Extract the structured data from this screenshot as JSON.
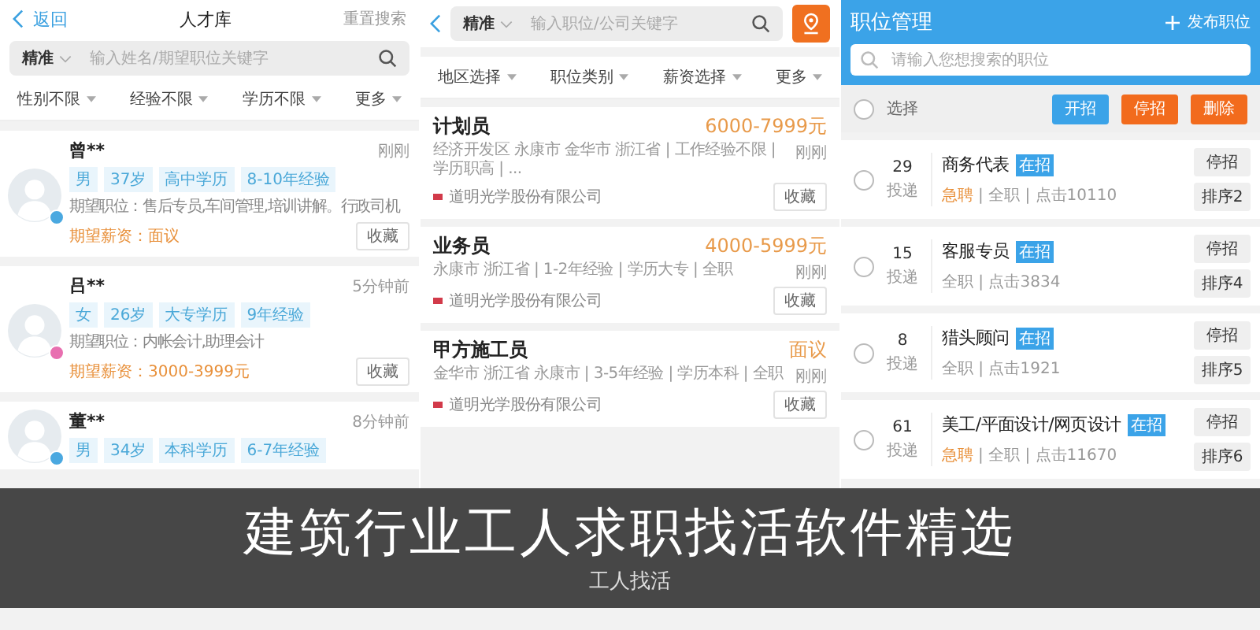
{
  "talent_screen": {
    "header": {
      "back": "返回",
      "title": "人才库",
      "action": "重置搜索"
    },
    "search": {
      "mode": "精准",
      "placeholder": "输入姓名/期望职位关键字"
    },
    "filters": [
      "性别不限",
      "经验不限",
      "学历不限",
      "更多"
    ],
    "candidates": [
      {
        "name": "曾**",
        "time": "刚刚",
        "tags": [
          "男",
          "37岁",
          "高中学历",
          "8-10年经验"
        ],
        "color": "#4aa8e0",
        "expected_position": "期望职位：售后专员,车间管理,培训讲解。行政司机",
        "expected_salary": "期望薪资：面议",
        "button": "收藏"
      },
      {
        "name": "吕**",
        "time": "5分钟前",
        "tags": [
          "女",
          "26岁",
          "大专学历",
          "9年经验"
        ],
        "color": "#e86fb0",
        "expected_position": "期望职位：内帐会计,助理会计",
        "expected_salary": "期望薪资：3000-3999元",
        "button": "收藏"
      },
      {
        "name": "董**",
        "time": "8分钟前",
        "tags": [
          "男",
          "34岁",
          "本科学历",
          "6-7年经验"
        ],
        "color": "#4aa8e0"
      }
    ]
  },
  "job_screen": {
    "search": {
      "mode": "精准",
      "placeholder": "输入职位/公司关键字"
    },
    "filters": [
      "地区选择",
      "职位类别",
      "薪资选择",
      "更多"
    ],
    "jobs": [
      {
        "title": "计划员",
        "salary": "6000-7999元",
        "meta": "经济开发区 永康市 金华市 浙江省 | 工作经验不限 | 学历职高 | ...",
        "time": "刚刚",
        "company": "道明光学股份有限公司",
        "button": "收藏"
      },
      {
        "title": "业务员",
        "salary": "4000-5999元",
        "meta": "永康市 浙江省 | 1-2年经验 | 学历大专 | 全职",
        "time": "刚刚",
        "company": "道明光学股份有限公司",
        "button": "收藏"
      },
      {
        "title": "甲方施工员",
        "salary": "面议",
        "meta": "金华市 浙江省 永康市 | 3-5年经验 | 学历本科 | 全职",
        "time": "刚刚",
        "company": "道明光学股份有限公司",
        "button": "收藏"
      }
    ]
  },
  "manage_screen": {
    "title": "职位管理",
    "publish": "发布职位",
    "search": {
      "placeholder": "请输入您想搜索的职位"
    },
    "select_label": "选择",
    "select_all": false,
    "bulk_buttons": [
      {
        "label": "开招",
        "kind": "primary"
      },
      {
        "label": "停招",
        "kind": "warning"
      },
      {
        "label": "删除",
        "kind": "warning"
      }
    ],
    "positions": [
      {
        "count": "29",
        "count_label": "投递",
        "title": "商务代表",
        "status": "在招",
        "urgent": "急聘",
        "meta": "| 全职 | 点击10110",
        "actions": [
          "停招",
          "排序2"
        ],
        "selected": false
      },
      {
        "count": "15",
        "count_label": "投递",
        "title": "客服专员",
        "status": "在招",
        "meta": "全职 | 点击3834",
        "actions": [
          "停招",
          "排序4"
        ],
        "selected": false
      },
      {
        "count": "8",
        "count_label": "投递",
        "title": "猎头顾问",
        "status": "在招",
        "meta": "全职 | 点击1921",
        "actions": [
          "停招",
          "排序5"
        ],
        "selected": false
      },
      {
        "count": "61",
        "count_label": "投递",
        "title": "美工/平面设计/网页设计",
        "status": "在招",
        "urgent": "急聘",
        "meta": "| 全职 | 点击11670",
        "actions": [
          "停招",
          "排序6"
        ],
        "selected": false
      }
    ]
  },
  "banner": {
    "title": "建筑行业工人求职找活软件精选",
    "subtitle": "工人找活"
  }
}
